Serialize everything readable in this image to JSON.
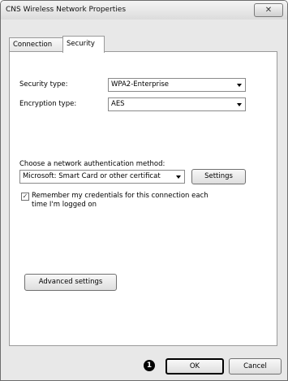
{
  "window": {
    "title": "CNS Wireless Network Properties",
    "close_glyph": "✕"
  },
  "tabs": [
    {
      "label": "Connection",
      "selected": false
    },
    {
      "label": "Security",
      "selected": true
    }
  ],
  "security": {
    "security_type_label": "Security type:",
    "security_type_value": "WPA2-Enterprise",
    "encryption_type_label": "Encryption type:",
    "encryption_type_value": "AES",
    "auth_method_label": "Choose a network authentication method:",
    "auth_method_value": "Microsoft: Smart Card or other certificat",
    "settings_label": "Settings",
    "remember_label_line1": "Remember my credentials for this connection each",
    "remember_label_line2": "time I'm logged on",
    "remember_checked": true,
    "check_glyph": "✓",
    "advanced_label": "Advanced settings"
  },
  "footer": {
    "callout_number": "1",
    "ok_label": "OK",
    "cancel_label": "Cancel"
  },
  "icons": {
    "close": "close-icon",
    "dropdown": "chevron-down-icon",
    "check": "check-icon"
  }
}
